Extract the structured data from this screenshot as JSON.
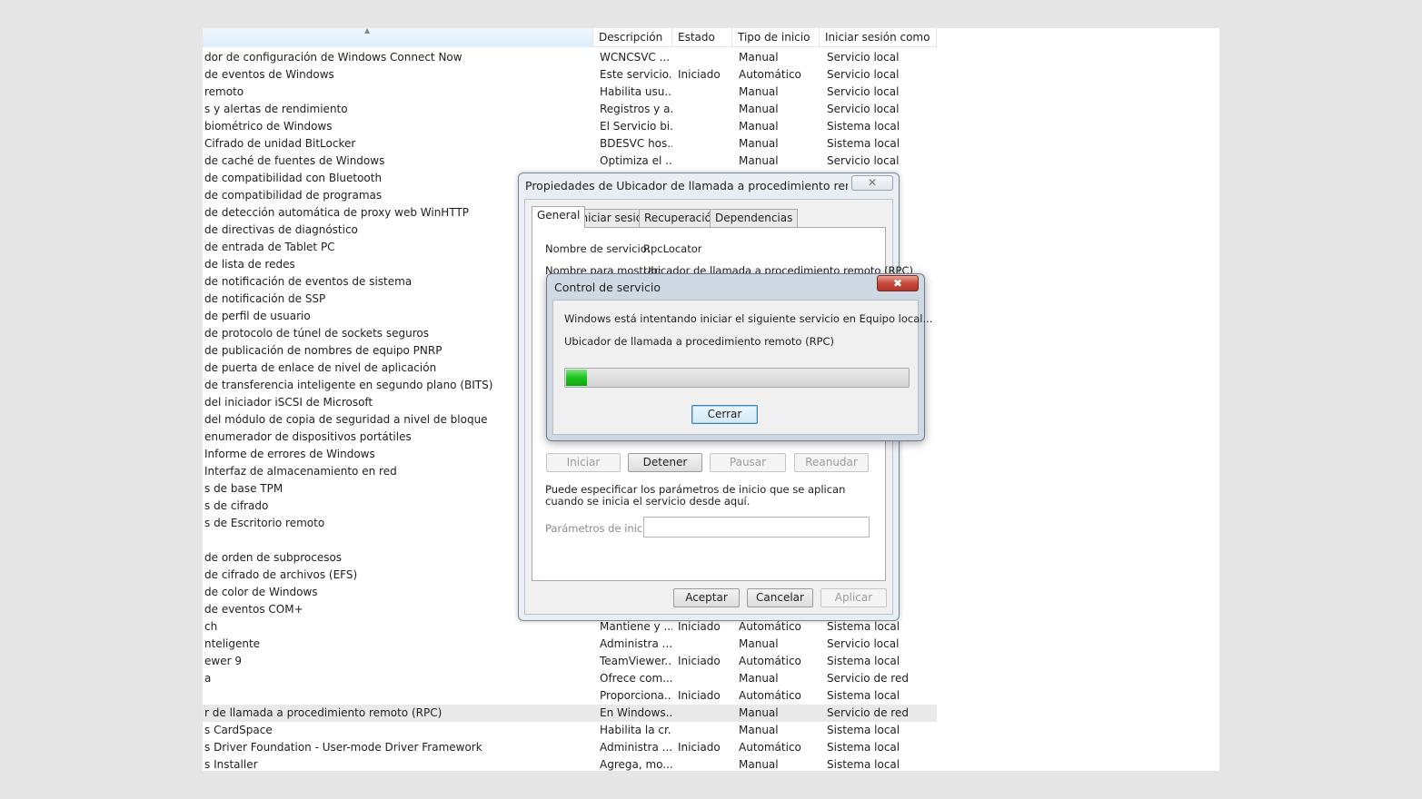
{
  "services": {
    "headers": [
      "Descripción",
      "Estado",
      "Tipo de inicio",
      "Iniciar sesión como"
    ],
    "rows": [
      {
        "name": "dor de configuración de Windows Connect Now",
        "desc": "WCNCSVC ...",
        "state": "",
        "start": "Manual",
        "logon": "Servicio local"
      },
      {
        "name": " de eventos de Windows",
        "desc": "Este servicio...",
        "state": "Iniciado",
        "start": "Automático",
        "logon": "Servicio local"
      },
      {
        "name": " remoto",
        "desc": "Habilita usu...",
        "state": "",
        "start": "Manual",
        "logon": "Servicio local"
      },
      {
        "name": "s y alertas de rendimiento",
        "desc": "Registros y a...",
        "state": "",
        "start": "Manual",
        "logon": "Servicio local"
      },
      {
        "name": " biométrico de Windows",
        "desc": "El Servicio bi...",
        "state": "",
        "start": "Manual",
        "logon": "Sistema local"
      },
      {
        "name": " Cifrado de unidad BitLocker",
        "desc": "BDESVC hos...",
        "state": "",
        "start": "Manual",
        "logon": "Sistema local"
      },
      {
        "name": " de caché de fuentes de Windows",
        "desc": "Optimiza el ...",
        "state": "",
        "start": "Manual",
        "logon": "Servicio local"
      },
      {
        "name": " de compatibilidad con Bluetooth",
        "desc": "",
        "state": "",
        "start": "",
        "logon": ""
      },
      {
        "name": " de compatibilidad de programas",
        "desc": "",
        "state": "",
        "start": "",
        "logon": ""
      },
      {
        "name": " de detección automática de proxy web WinHTTP",
        "desc": "",
        "state": "",
        "start": "",
        "logon": ""
      },
      {
        "name": " de directivas de diagnóstico",
        "desc": "",
        "state": "",
        "start": "",
        "logon": ""
      },
      {
        "name": " de entrada de Tablet PC",
        "desc": "",
        "state": "",
        "start": "",
        "logon": ""
      },
      {
        "name": " de lista de redes",
        "desc": "",
        "state": "",
        "start": "",
        "logon": ""
      },
      {
        "name": " de notificación de eventos de sistema",
        "desc": "",
        "state": "",
        "start": "",
        "logon": ""
      },
      {
        "name": " de notificación de SSP",
        "desc": "",
        "state": "",
        "start": "",
        "logon": ""
      },
      {
        "name": " de perfil de usuario",
        "desc": "",
        "state": "",
        "start": "",
        "logon": ""
      },
      {
        "name": " de protocolo de túnel de sockets seguros",
        "desc": "",
        "state": "",
        "start": "",
        "logon": ""
      },
      {
        "name": " de publicación de nombres de equipo PNRP",
        "desc": "",
        "state": "",
        "start": "",
        "logon": ""
      },
      {
        "name": " de puerta de enlace de nivel de aplicación",
        "desc": "",
        "state": "",
        "start": "",
        "logon": ""
      },
      {
        "name": " de transferencia inteligente en segundo plano (BITS)",
        "desc": "",
        "state": "",
        "start": "",
        "logon": ""
      },
      {
        "name": " del iniciador iSCSI de Microsoft",
        "desc": "",
        "state": "",
        "start": "",
        "logon": ""
      },
      {
        "name": " del módulo de copia de seguridad a nivel de bloque",
        "desc": "",
        "state": "",
        "start": "",
        "logon": ""
      },
      {
        "name": " enumerador de dispositivos portátiles",
        "desc": "",
        "state": "",
        "start": "",
        "logon": ""
      },
      {
        "name": " Informe de errores de Windows",
        "desc": "",
        "state": "",
        "start": "",
        "logon": ""
      },
      {
        "name": " Interfaz de almacenamiento en red",
        "desc": "",
        "state": "",
        "start": "",
        "logon": ""
      },
      {
        "name": "s de base TPM",
        "desc": "",
        "state": "",
        "start": "",
        "logon": ""
      },
      {
        "name": "s de cifrado",
        "desc": "",
        "state": "",
        "start": "",
        "logon": ""
      },
      {
        "name": "s de Escritorio remoto",
        "desc": "",
        "state": "",
        "start": "",
        "logon": ""
      },
      {
        "name": "",
        "desc": "",
        "state": "",
        "start": "",
        "logon": ""
      },
      {
        "name": " de orden de subprocesos",
        "desc": "",
        "state": "",
        "start": "",
        "logon": ""
      },
      {
        "name": " de cifrado de archivos (EFS)",
        "desc": "",
        "state": "",
        "start": "",
        "logon": ""
      },
      {
        "name": " de color de Windows",
        "desc": "",
        "state": "",
        "start": "",
        "logon": ""
      },
      {
        "name": " de eventos COM+",
        "desc": "",
        "state": "",
        "start": "",
        "logon": ""
      },
      {
        "name": "ch",
        "desc": "Mantiene y ...",
        "state": "Iniciado",
        "start": "Automático",
        "logon": "Sistema local"
      },
      {
        "name": "nteligente",
        "desc": "Administra ...",
        "state": "",
        "start": "Manual",
        "logon": "Servicio local"
      },
      {
        "name": "ewer 9",
        "desc": "TeamViewer...",
        "state": "Iniciado",
        "start": "Automático",
        "logon": "Sistema local"
      },
      {
        "name": "a",
        "desc": "Ofrece com...",
        "state": "",
        "start": "Manual",
        "logon": "Servicio de red"
      },
      {
        "name": "",
        "desc": "Proporciona...",
        "state": "Iniciado",
        "start": "Automático",
        "logon": "Sistema local"
      },
      {
        "name": "r de llamada a procedimiento remoto (RPC)",
        "desc": "En Windows...",
        "state": "",
        "start": "Manual",
        "logon": "Servicio de red"
      },
      {
        "name": "s CardSpace",
        "desc": "Habilita la cr...",
        "state": "",
        "start": "Manual",
        "logon": "Sistema local"
      },
      {
        "name": "s Driver Foundation - User-mode Driver Framework",
        "desc": "Administra ...",
        "state": "Iniciado",
        "start": "Automático",
        "logon": "Sistema local"
      },
      {
        "name": "s Installer",
        "desc": "Agrega, mo...",
        "state": "",
        "start": "Manual",
        "logon": "Sistema local"
      }
    ]
  },
  "properties": {
    "title": "Propiedades de Ubicador de llamada a procedimiento remoto (R...",
    "tabs": [
      "General",
      "Iniciar sesión",
      "Recuperación",
      "Dependencias"
    ],
    "service_name_label": "Nombre de servicio:",
    "service_name_value": "RpcLocator",
    "display_name_label": "Nombre para mostrar:",
    "display_name_value": "Ubicador de llamada a procedimiento remoto (RPC)",
    "buttons": {
      "start": "Iniciar",
      "stop": "Detener",
      "pause": "Pausar",
      "resume": "Reanudar"
    },
    "hint": "Puede especificar los parámetros de inicio que se aplican cuando se inicia el servicio desde aquí.",
    "params_label": "Parámetros de inicio:",
    "params_value": "",
    "ok": "Aceptar",
    "cancel": "Cancelar",
    "apply": "Aplicar"
  },
  "control": {
    "title": "Control de servicio",
    "message": "Windows está intentando iniciar el siguiente servicio en Equipo local...",
    "service": "Ubicador de llamada a procedimiento remoto (RPC)",
    "progress": 0.06,
    "close_label": "Cerrar",
    "close_glyph": "✖"
  },
  "colors": {
    "progress_green": "#1ec41e",
    "close_red": "#c5483a"
  }
}
